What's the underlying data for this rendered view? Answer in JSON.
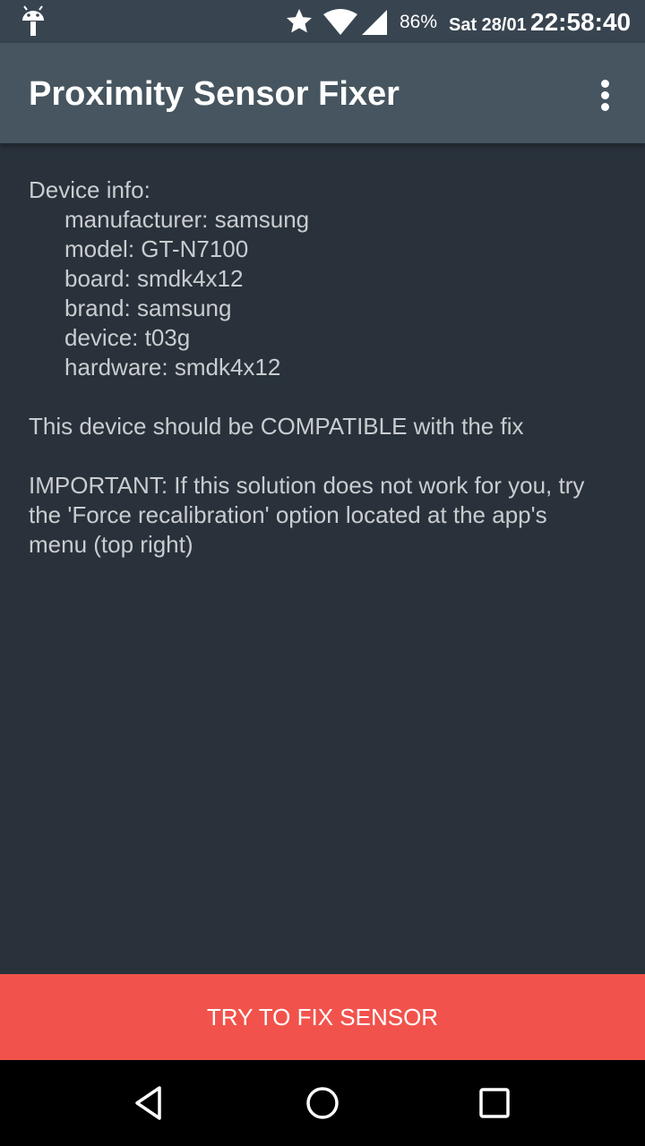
{
  "status_bar": {
    "battery": "86%",
    "date": "Sat 28/01",
    "time": "22:58:40",
    "icons": [
      "android-icon",
      "star-icon",
      "wifi-icon",
      "signal-icon"
    ]
  },
  "app_bar": {
    "title": "Proximity Sensor Fixer",
    "menu_icon": "overflow-menu-icon"
  },
  "device_info": {
    "heading": "Device info:",
    "manufacturer": "manufacturer: samsung",
    "model": "model: GT-N7100",
    "board": "board: smdk4x12",
    "brand": "brand: samsung",
    "device": "device: t03g",
    "hardware": "hardware: smdk4x12"
  },
  "messages": {
    "compatibility": "This device should be COMPATIBLE with the fix",
    "important": "IMPORTANT: If this solution does not work for you, try the 'Force recalibration' option located at the app's menu (top right)"
  },
  "fix_button": {
    "label": "TRY TO FIX SENSOR"
  },
  "nav_bar": {
    "icons": [
      "back-icon",
      "home-icon",
      "recents-icon"
    ]
  },
  "colors": {
    "status_bar": "#384550",
    "app_bar": "#46555f",
    "background": "#29323a",
    "accent": "#f1534c",
    "text": "#c9cdd0"
  }
}
